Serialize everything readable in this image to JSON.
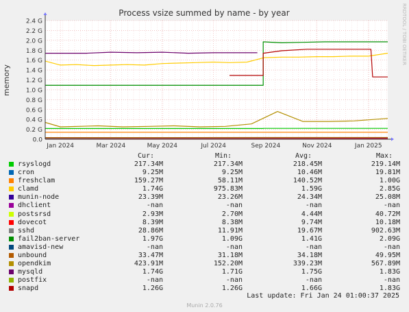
{
  "chart_data": {
    "type": "line",
    "title": "Process vsize summed by name - by year",
    "ylabel": "memory",
    "watermark": "RRDTOOL / TOBI OETIKER",
    "ylim": [
      0,
      2.4
    ],
    "yticks": [
      "0.0",
      "0.2 G",
      "0.4 G",
      "0.6 G",
      "0.8 G",
      "1.0 G",
      "1.2 G",
      "1.4 G",
      "1.6 G",
      "1.8 G",
      "2.0 G",
      "2.2 G",
      "2.4 G"
    ],
    "xticks": [
      "Jan 2024",
      "Mar 2024",
      "May 2024",
      "Jul 2024",
      "Sep 2024",
      "Nov 2024",
      "Jan 2025"
    ],
    "xrange": [
      "2023-12-14",
      "2025-01-24"
    ],
    "grid": true,
    "series": [
      {
        "name": "rsyslogd",
        "color": "#00cc00",
        "x": [
          "2023-12-14",
          "2024-08-29",
          "2024-08-29",
          "2025-01-24"
        ],
        "values": [
          0.217,
          0.217,
          0.219,
          0.219
        ]
      },
      {
        "name": "cron",
        "color": "#0066b3",
        "x": [
          "2023-12-14",
          "2025-01-24"
        ],
        "values": [
          0.01,
          0.01
        ]
      },
      {
        "name": "freshclam",
        "color": "#ff8000",
        "x": [
          "2023-12-14",
          "2025-01-24"
        ],
        "values": [
          0.14,
          0.14
        ]
      },
      {
        "name": "clamd",
        "color": "#ffcc00",
        "x": [
          "2023-12-14",
          "2024-01-01",
          "2024-01-20",
          "2024-02-10",
          "2024-03-01",
          "2024-03-20",
          "2024-04-10",
          "2024-05-01",
          "2024-05-20",
          "2024-06-10",
          "2024-07-01",
          "2024-07-20",
          "2024-08-10",
          "2024-08-30",
          "2024-09-20",
          "2024-10-10",
          "2024-11-01",
          "2024-11-20",
          "2024-12-10",
          "2025-01-01",
          "2025-01-24"
        ],
        "values": [
          1.58,
          1.5,
          1.51,
          1.49,
          1.5,
          1.51,
          1.5,
          1.53,
          1.54,
          1.55,
          1.56,
          1.55,
          1.56,
          1.65,
          1.66,
          1.66,
          1.67,
          1.67,
          1.68,
          1.68,
          1.74
        ]
      },
      {
        "name": "munin-node",
        "color": "#330099",
        "x": [
          "2023-12-14",
          "2025-01-24"
        ],
        "values": [
          0.023,
          0.023
        ]
      },
      {
        "name": "dhclient",
        "color": "#990099",
        "x": [],
        "values": []
      },
      {
        "name": "postsrsd",
        "color": "#ccff00",
        "x": [
          "2023-12-14",
          "2025-01-24"
        ],
        "values": [
          0.003,
          0.003
        ]
      },
      {
        "name": "dovecot",
        "color": "#ff0000",
        "x": [
          "2023-12-14",
          "2025-01-24"
        ],
        "values": [
          0.008,
          0.008
        ]
      },
      {
        "name": "sshd",
        "color": "#808080",
        "x": [
          "2023-12-14",
          "2025-01-24"
        ],
        "values": [
          0.02,
          0.03
        ]
      },
      {
        "name": "fail2ban-server",
        "color": "#008f00",
        "x": [
          "2023-12-14",
          "2024-08-29",
          "2024-08-29",
          "2024-09-20",
          "2024-10-15",
          "2024-11-10",
          "2024-12-10",
          "2025-01-24"
        ],
        "values": [
          1.09,
          1.09,
          1.97,
          1.95,
          1.96,
          1.97,
          1.97,
          1.97
        ]
      },
      {
        "name": "amavisd-new",
        "color": "#00487d",
        "x": [],
        "values": []
      },
      {
        "name": "unbound",
        "color": "#b35a00",
        "x": [
          "2023-12-14",
          "2025-01-24"
        ],
        "values": [
          0.033,
          0.034
        ]
      },
      {
        "name": "opendkim",
        "color": "#b38f00",
        "x": [
          "2023-12-14",
          "2024-01-01",
          "2024-02-15",
          "2024-03-15",
          "2024-04-15",
          "2024-05-15",
          "2024-06-15",
          "2024-07-15",
          "2024-08-15",
          "2024-09-15",
          "2024-10-15",
          "2024-11-15",
          "2024-12-15",
          "2025-01-24"
        ],
        "values": [
          0.34,
          0.25,
          0.27,
          0.25,
          0.26,
          0.27,
          0.25,
          0.26,
          0.31,
          0.56,
          0.36,
          0.36,
          0.37,
          0.42
        ]
      },
      {
        "name": "mysqld",
        "color": "#6b006b",
        "x": [
          "2023-12-14",
          "2024-02-01",
          "2024-03-01",
          "2024-04-01",
          "2024-05-01",
          "2024-06-01",
          "2024-07-01",
          "2024-08-01",
          "2024-08-22"
        ],
        "values": [
          1.74,
          1.74,
          1.76,
          1.75,
          1.76,
          1.74,
          1.75,
          1.75,
          1.75
        ]
      },
      {
        "name": "postfix",
        "color": "#8fb300",
        "x": [],
        "values": []
      },
      {
        "name": "snapd",
        "color": "#b30000",
        "x": [
          "2024-07-20",
          "2024-08-29",
          "2024-08-29",
          "2024-09-20",
          "2024-10-20",
          "2024-11-20",
          "2024-12-20",
          "2025-01-04",
          "2025-01-06",
          "2025-01-24"
        ],
        "values": [
          1.29,
          1.29,
          1.74,
          1.79,
          1.82,
          1.82,
          1.82,
          1.82,
          1.26,
          1.26
        ]
      }
    ]
  },
  "legend": {
    "headers": {
      "cur": "Cur:",
      "min": "Min:",
      "avg": "Avg:",
      "max": "Max:"
    },
    "rows": [
      {
        "name": "rsyslogd",
        "color": "#00cc00",
        "cur": "217.34M",
        "min": "217.34M",
        "avg": "218.45M",
        "max": "219.14M"
      },
      {
        "name": "cron",
        "color": "#0066b3",
        "cur": "9.25M",
        "min": "9.25M",
        "avg": "10.46M",
        "max": "19.81M"
      },
      {
        "name": "freshclam",
        "color": "#ff8000",
        "cur": "159.27M",
        "min": "58.11M",
        "avg": "140.52M",
        "max": "1.00G"
      },
      {
        "name": "clamd",
        "color": "#ffcc00",
        "cur": "1.74G",
        "min": "975.83M",
        "avg": "1.59G",
        "max": "2.85G"
      },
      {
        "name": "munin-node",
        "color": "#330099",
        "cur": "23.39M",
        "min": "23.26M",
        "avg": "24.34M",
        "max": "25.08M"
      },
      {
        "name": "dhclient",
        "color": "#990099",
        "cur": "-nan",
        "min": "-nan",
        "avg": "-nan",
        "max": "-nan"
      },
      {
        "name": "postsrsd",
        "color": "#ccff00",
        "cur": "2.93M",
        "min": "2.70M",
        "avg": "4.44M",
        "max": "40.72M"
      },
      {
        "name": "dovecot",
        "color": "#ff0000",
        "cur": "8.39M",
        "min": "8.38M",
        "avg": "9.74M",
        "max": "10.18M"
      },
      {
        "name": "sshd",
        "color": "#808080",
        "cur": "28.86M",
        "min": "11.91M",
        "avg": "19.67M",
        "max": "902.63M"
      },
      {
        "name": "fail2ban-server",
        "color": "#008f00",
        "cur": "1.97G",
        "min": "1.09G",
        "avg": "1.41G",
        "max": "2.09G"
      },
      {
        "name": "amavisd-new",
        "color": "#00487d",
        "cur": "-nan",
        "min": "-nan",
        "avg": "-nan",
        "max": "-nan"
      },
      {
        "name": "unbound",
        "color": "#b35a00",
        "cur": "33.47M",
        "min": "31.18M",
        "avg": "34.18M",
        "max": "49.95M"
      },
      {
        "name": "opendkim",
        "color": "#b38f00",
        "cur": "423.91M",
        "min": "152.20M",
        "avg": "339.23M",
        "max": "567.89M"
      },
      {
        "name": "mysqld",
        "color": "#6b006b",
        "cur": "1.74G",
        "min": "1.71G",
        "avg": "1.75G",
        "max": "1.83G"
      },
      {
        "name": "postfix",
        "color": "#8fb300",
        "cur": "-nan",
        "min": "-nan",
        "avg": "-nan",
        "max": "-nan"
      },
      {
        "name": "snapd",
        "color": "#b30000",
        "cur": "1.26G",
        "min": "1.26G",
        "avg": "1.66G",
        "max": "1.83G"
      }
    ]
  },
  "last_update": "Last update: Fri Jan 24 01:00:37 2025",
  "footer": "Munin 2.0.76"
}
